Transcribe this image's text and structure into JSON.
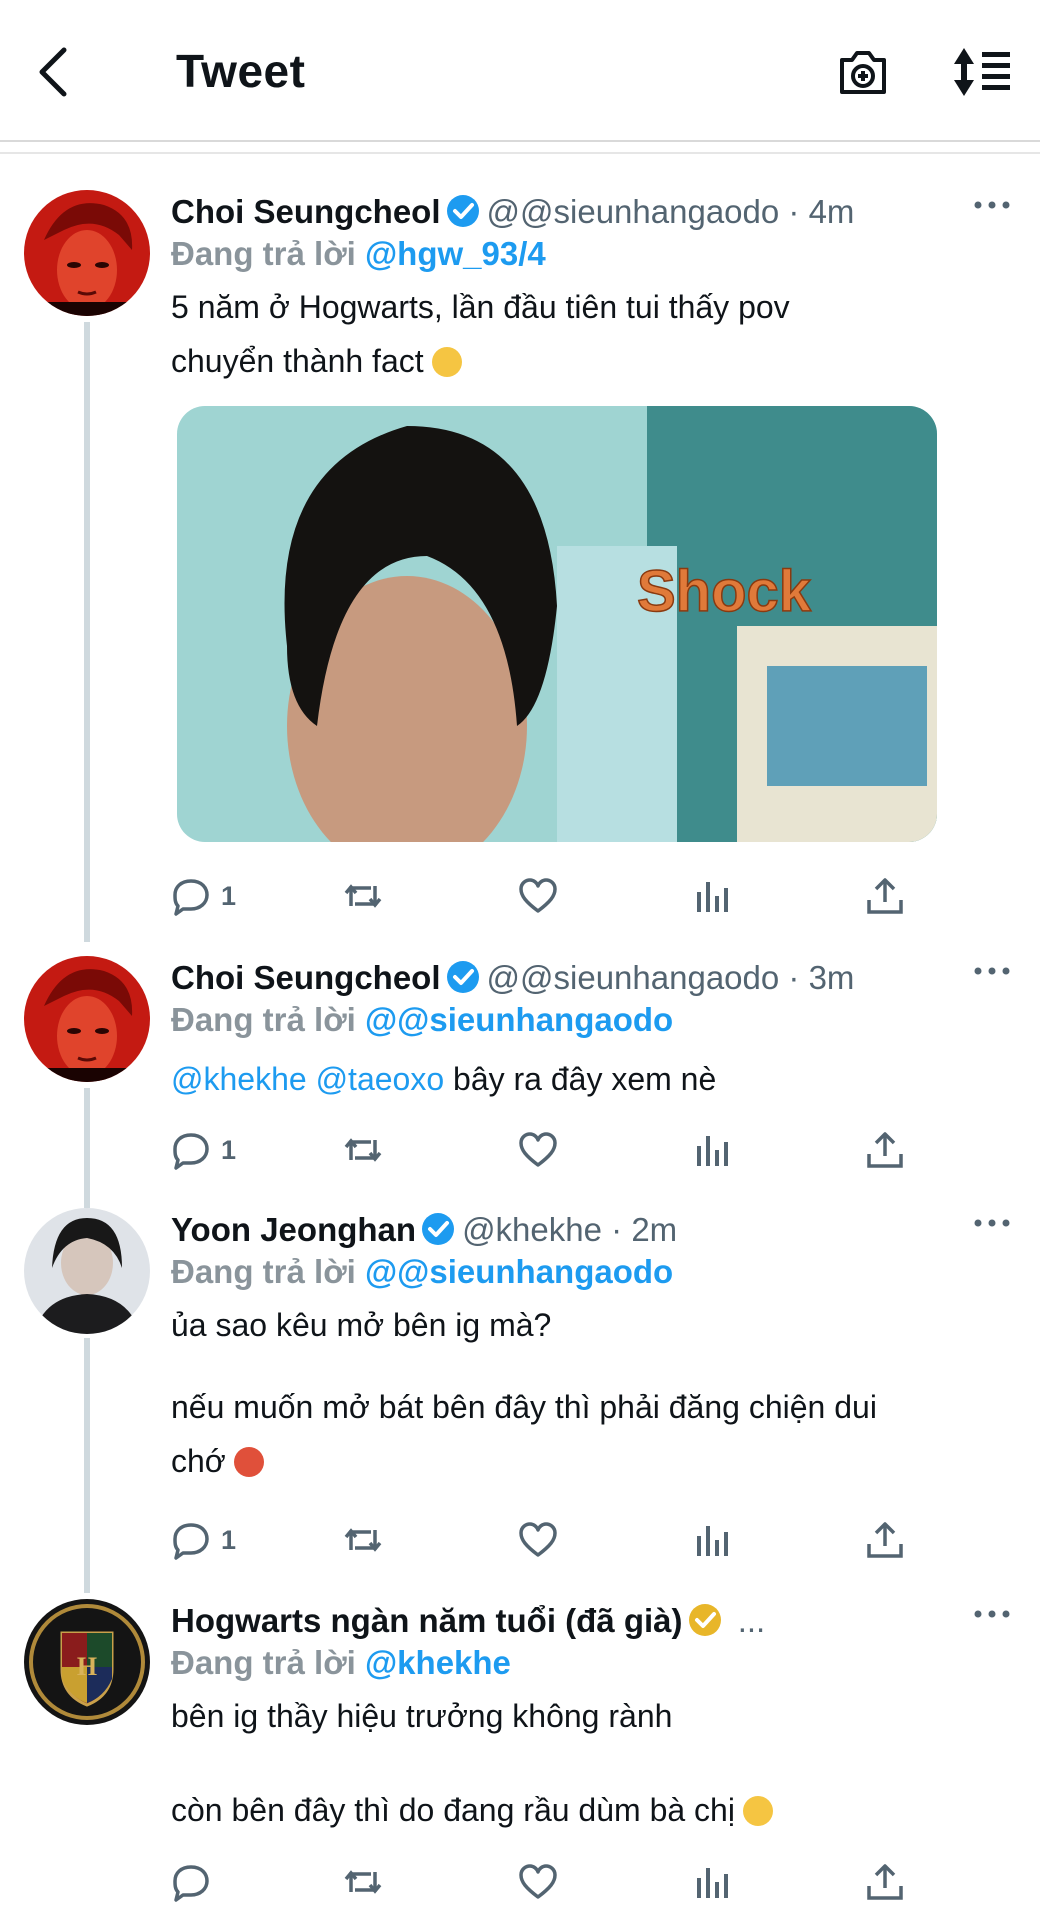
{
  "header": {
    "title": "Tweet"
  },
  "tweets": [
    {
      "name": "Choi Seungcheol",
      "handle": "@@sieunhangaodo",
      "dot": "·",
      "time": "4m",
      "replying_label": "Đang trả lời",
      "replying_to": "@hgw_93/4",
      "text_lines": [
        "5 năm ở Hogwarts, lần đầu tiên tui thấy pov",
        "chuyển thành fact"
      ],
      "media_text": "Shock",
      "reply_count": "1"
    },
    {
      "name": "Choi Seungcheol",
      "handle": "@@sieunhangaodo",
      "dot": "·",
      "time": "3m",
      "replying_label": "Đang trả lời",
      "replying_to": "@@sieunhangaodo",
      "mention1": "@khekhe",
      "mention2": "@taeoxo",
      "text_rest": "bây ra đây xem nè",
      "reply_count": "1"
    },
    {
      "name": "Yoon Jeonghan",
      "handle": "@khekhe",
      "dot": "·",
      "time": "2m",
      "replying_label": "Đang trả lời",
      "replying_to": "@@sieunhangaodo",
      "para1": "ủa sao kêu mở bên ig mà?",
      "para2_line1": "nếu muốn mở bát bên đây thì phải đăng chiện dui",
      "para2_line2": "chớ",
      "reply_count": "1"
    },
    {
      "name": "Hogwarts ngàn năm tuổi (đã già)",
      "handle": "...",
      "replying_label": "Đang trả lời",
      "replying_to": "@khekhe",
      "para1": "bên ig thầy hiệu trưởng không rành",
      "para2": "còn bên đây thì do đang rầu dùm bà chị",
      "reply_count": ""
    }
  ],
  "icons": {
    "back": "chevron-left-icon",
    "camera": "camera-plus-icon",
    "sort": "sort-icon",
    "verified": "verified-badge-icon",
    "more": "more-icon",
    "reply": "reply-icon",
    "retweet": "retweet-icon",
    "like": "heart-icon",
    "views": "views-icon",
    "share": "share-icon"
  },
  "colors": {
    "accent": "#1d9bf0",
    "gold": "#e8b629",
    "muted": "#536471",
    "text": "#0f1419"
  }
}
